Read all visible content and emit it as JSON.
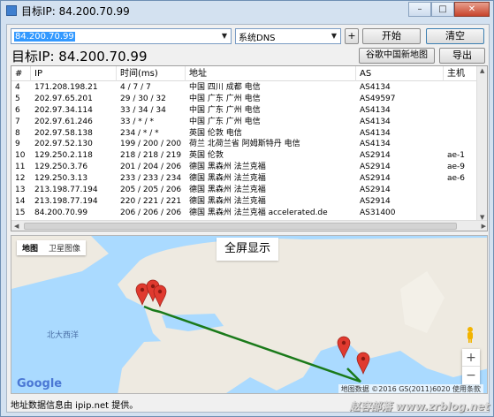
{
  "window": {
    "title": "目标IP: 84.200.70.99",
    "min": "–",
    "max": "□",
    "close": "✕"
  },
  "toolbar": {
    "ip_value": "84.200.70.99",
    "dns_value": "系统DNS",
    "plus_label": "+",
    "start_label": "开始",
    "clear_label": "清空",
    "google_map_label": "谷歌中国新地图",
    "export_label": "导出"
  },
  "target_label": "目标IP:  84.200.70.99",
  "table": {
    "headers": [
      "#",
      "IP",
      "时间(ms)",
      "地址",
      "AS",
      "主机"
    ],
    "rows": [
      [
        "4",
        "171.208.198.21",
        "4 / 7 / 7",
        "中国 四川 成都 电信",
        "AS4134",
        ""
      ],
      [
        "5",
        "202.97.65.201",
        "29 / 30 / 32",
        "中国 广东 广州 电信",
        "AS49597",
        ""
      ],
      [
        "6",
        "202.97.34.114",
        "33 / 34 / 34",
        "中国 广东 广州 电信",
        "AS4134",
        ""
      ],
      [
        "7",
        "202.97.61.246",
        "33 / * / *",
        "中国 广东 广州 电信",
        "AS4134",
        ""
      ],
      [
        "8",
        "202.97.58.138",
        "234 / * / *",
        "英国 伦敦 电信",
        "AS4134",
        ""
      ],
      [
        "9",
        "202.97.52.130",
        "199 / 200 / 200",
        "荷兰 北荷兰省 阿姆斯特丹 电信",
        "AS4134",
        ""
      ],
      [
        "10",
        "129.250.2.118",
        "218 / 218 / 219",
        "英国 伦敦",
        "AS2914",
        "ae-1"
      ],
      [
        "11",
        "129.250.3.76",
        "201 / 204 / 206",
        "德国 黑森州 法兰克福",
        "AS2914",
        "ae-9"
      ],
      [
        "12",
        "129.250.3.13",
        "233 / 233 / 234",
        "德国 黑森州 法兰克福",
        "AS2914",
        "ae-6"
      ],
      [
        "13",
        "213.198.77.194",
        "205 / 205 / 206",
        "德国 黑森州 法兰克福",
        "AS2914",
        ""
      ],
      [
        "14",
        "213.198.77.194",
        "220 / 221 / 221",
        "德国 黑森州 法兰克福",
        "AS2914",
        ""
      ],
      [
        "15",
        "84.200.70.99",
        "206 / 206 / 206",
        "德国 黑森州 法兰克福 accelerated.de",
        "AS31400",
        ""
      ]
    ]
  },
  "map": {
    "type_map": "地图",
    "type_satellite": "卫星图像",
    "fullscreen": "全屏显示",
    "zoom_in": "+",
    "zoom_out": "−",
    "google": "Google",
    "attribution": "地图数据 ©2016 GS(2011)6020   使用条款",
    "ocean_label": "北大西洋",
    "route_color": "#1a7a1a",
    "marker_color": "#e03a2f"
  },
  "footer": "地址数据信息由 ipip.net 提供。",
  "watermark": "赵容部落 www.zrblog.net"
}
